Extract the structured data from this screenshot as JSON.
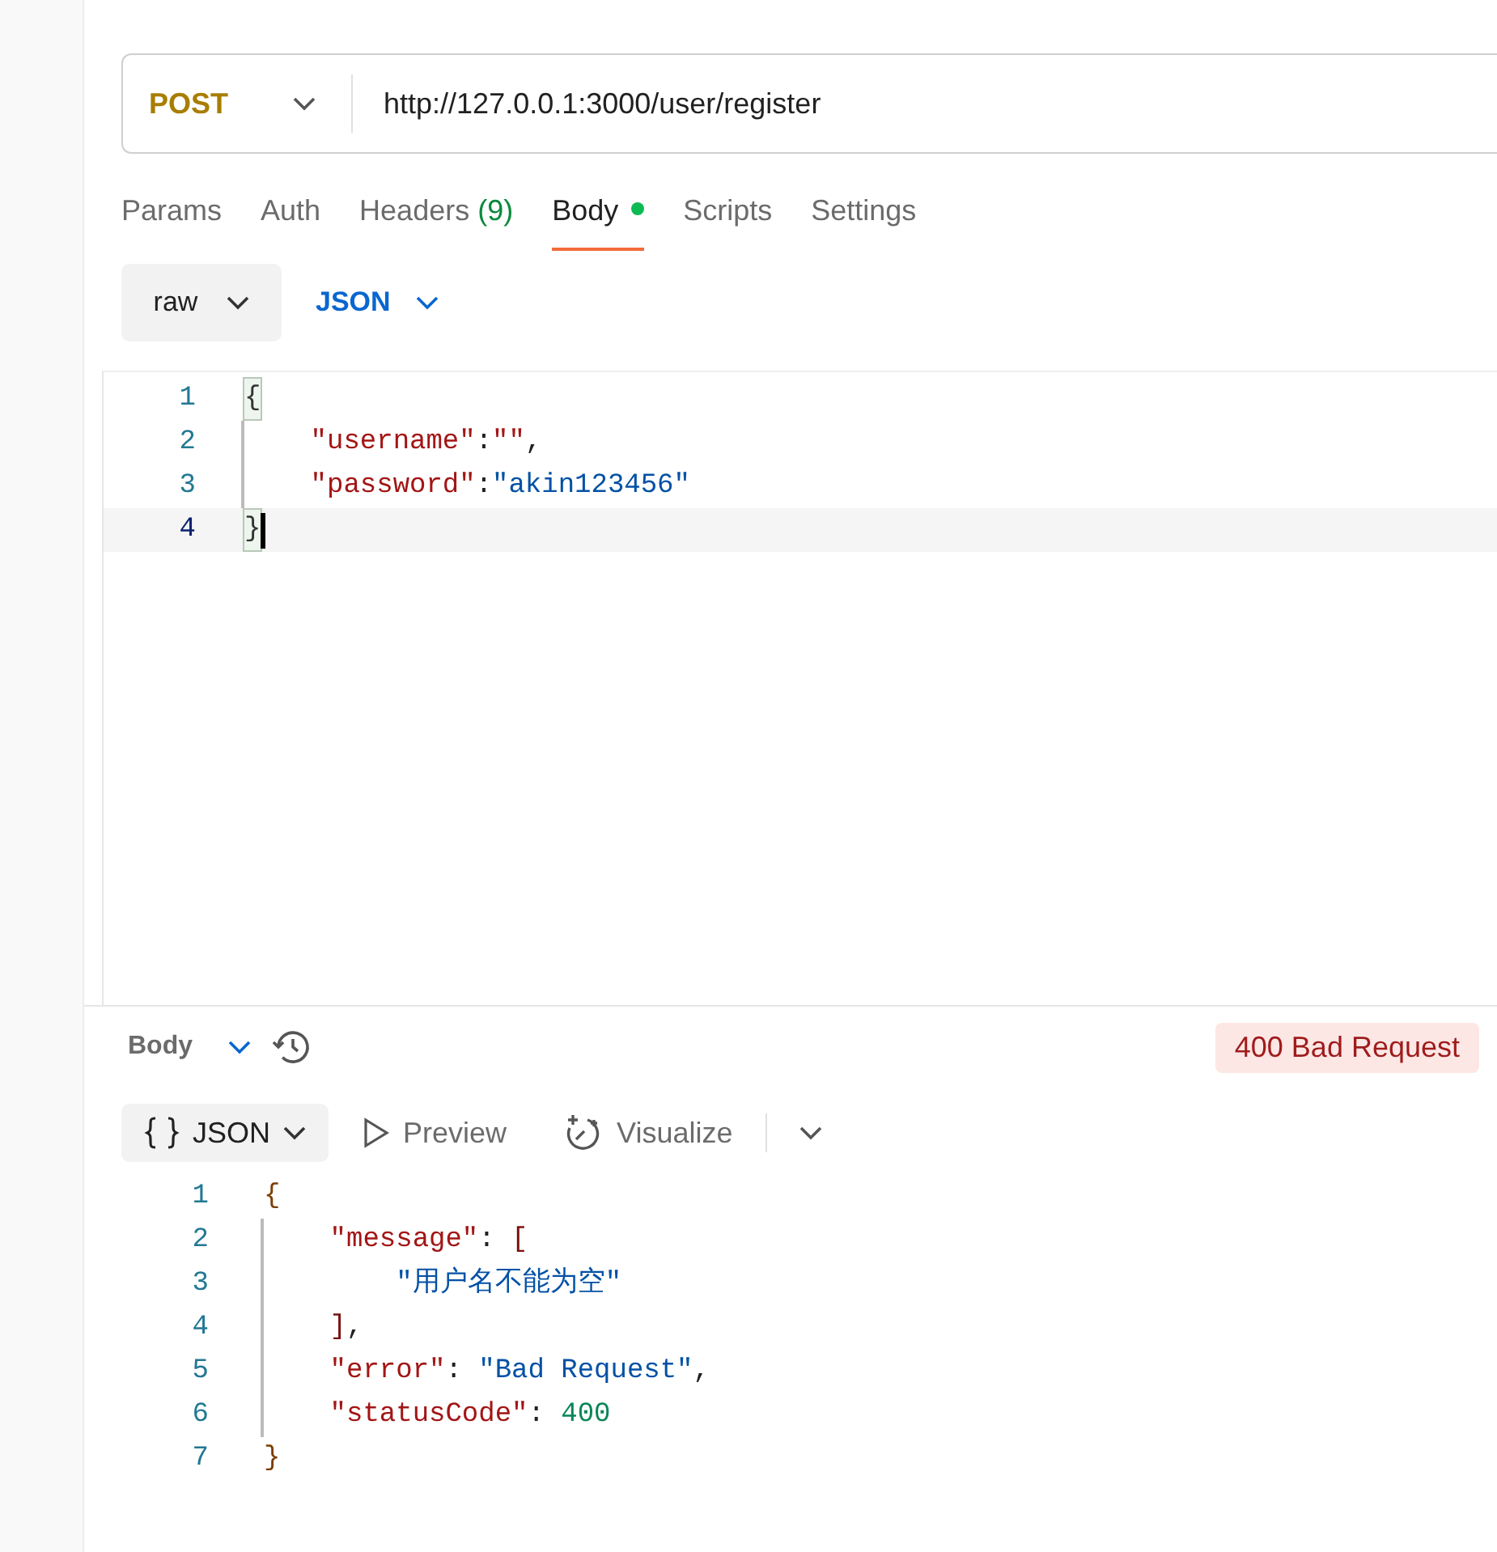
{
  "request": {
    "method": "POST",
    "url": "http://127.0.0.1:3000/user/register"
  },
  "request_tabs": [
    {
      "label": "Params",
      "selected": false
    },
    {
      "label": "Auth",
      "selected": false
    },
    {
      "label": "Headers",
      "count": "(9)",
      "selected": false
    },
    {
      "label": "Body",
      "selected": true,
      "modified": true
    },
    {
      "label": "Scripts",
      "selected": false
    },
    {
      "label": "Settings",
      "selected": false
    }
  ],
  "body_mode": "raw",
  "body_language": "JSON",
  "request_body": [
    {
      "number": "1",
      "current": false,
      "tokens": [
        {
          "kind": "brace_matched",
          "text": "{"
        }
      ]
    },
    {
      "number": "2",
      "current": false,
      "tokens": [
        {
          "kind": "key",
          "text": "    \"username\""
        },
        {
          "kind": "punct",
          "text": ":"
        },
        {
          "kind": "key",
          "text": "\"\""
        },
        {
          "kind": "punct",
          "text": ","
        }
      ]
    },
    {
      "number": "3",
      "current": false,
      "tokens": [
        {
          "kind": "key",
          "text": "    \"password\""
        },
        {
          "kind": "punct",
          "text": ":"
        },
        {
          "kind": "string",
          "text": "\"akin123456\""
        }
      ]
    },
    {
      "number": "4",
      "current": true,
      "tokens": [
        {
          "kind": "brace_matched",
          "text": "}"
        }
      ]
    }
  ],
  "response": {
    "section": "Body",
    "status": "400 Bad Request",
    "view_modes": [
      {
        "kind": "json",
        "label": "JSON",
        "selected": true
      },
      {
        "kind": "preview",
        "label": "Preview",
        "selected": false
      },
      {
        "kind": "visualize",
        "label": "Visualize",
        "selected": false
      }
    ],
    "lines": [
      {
        "number": "1",
        "tokens": [
          {
            "kind": "brace",
            "text": "{"
          }
        ]
      },
      {
        "number": "2",
        "tokens": [
          {
            "kind": "key",
            "text": "    \"message\""
          },
          {
            "kind": "punct",
            "text": ": "
          },
          {
            "kind": "bracket",
            "text": "["
          }
        ]
      },
      {
        "number": "3",
        "tokens": [
          {
            "kind": "string",
            "text": "        \"用户名不能为空\""
          }
        ]
      },
      {
        "number": "4",
        "tokens": [
          {
            "kind": "bracket",
            "text": "    ]"
          },
          {
            "kind": "punct",
            "text": ","
          }
        ]
      },
      {
        "number": "5",
        "tokens": [
          {
            "kind": "key",
            "text": "    \"error\""
          },
          {
            "kind": "punct",
            "text": ": "
          },
          {
            "kind": "string",
            "text": "\"Bad Request\""
          },
          {
            "kind": "punct",
            "text": ","
          }
        ]
      },
      {
        "number": "6",
        "tokens": [
          {
            "kind": "key",
            "text": "    \"statusCode\""
          },
          {
            "kind": "punct",
            "text": ": "
          },
          {
            "kind": "number",
            "text": "400"
          }
        ]
      },
      {
        "number": "7",
        "tokens": [
          {
            "kind": "brace",
            "text": "}"
          }
        ]
      }
    ]
  }
}
